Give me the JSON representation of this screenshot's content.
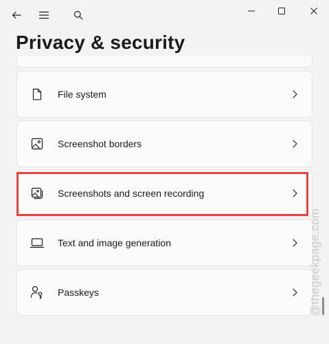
{
  "header": {
    "page_title": "Privacy & security"
  },
  "titlebar": {
    "back_icon": "back-arrow-icon",
    "menu_icon": "hamburger-menu-icon",
    "search_icon": "search-icon",
    "minimize_icon": "minimize-icon",
    "maximize_icon": "maximize-icon",
    "close_icon": "close-icon"
  },
  "settings": {
    "items": [
      {
        "label": "File system",
        "icon": "document-icon"
      },
      {
        "label": "Screenshot borders",
        "icon": "image-icon"
      },
      {
        "label": "Screenshots and screen recording",
        "icon": "screenshot-gallery-icon",
        "highlighted": true
      },
      {
        "label": "Text and image generation",
        "icon": "laptop-icon"
      },
      {
        "label": "Passkeys",
        "icon": "person-key-icon"
      }
    ]
  },
  "watermark": {
    "text": "@thegeekpage.com"
  },
  "colors": {
    "background": "#f3f3f3",
    "card": "#fbfbfb",
    "card_border": "#e5e5e5",
    "highlight": "#e8413f",
    "text": "#1b1b1b"
  }
}
